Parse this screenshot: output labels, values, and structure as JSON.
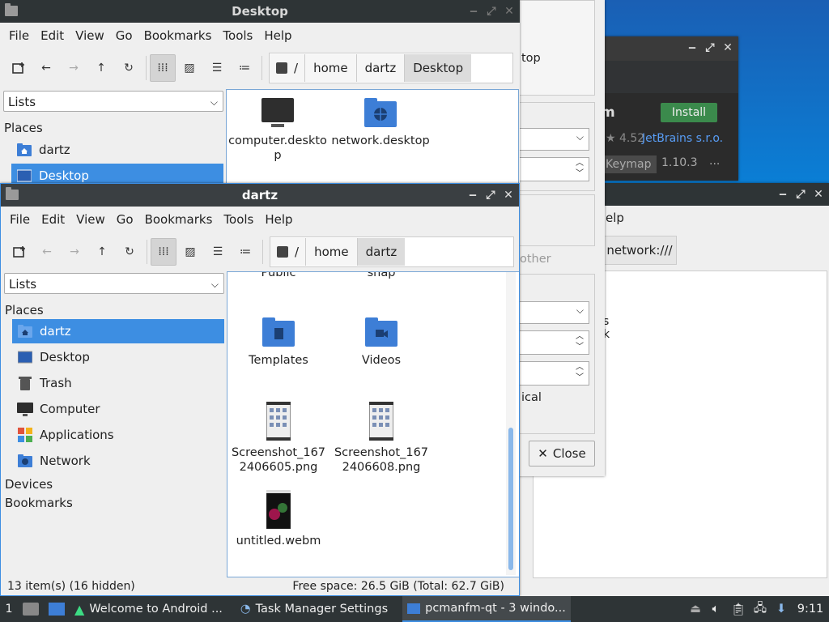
{
  "menu": [
    "File",
    "Edit",
    "View",
    "Go",
    "Bookmarks",
    "Tools",
    "Help"
  ],
  "crumbs": {
    "root": "/",
    "home": "home",
    "user": "dartz",
    "desktop": "Desktop"
  },
  "win_desktop": {
    "title": "Desktop",
    "combo": "Lists",
    "places_heading": "Places",
    "places": [
      {
        "label": "dartz"
      },
      {
        "label": "Desktop"
      }
    ],
    "files": [
      {
        "name": "computer.desktop",
        "icon": "monitor-icon"
      },
      {
        "name": "network.desktop",
        "icon": "network-folder-icon"
      }
    ]
  },
  "win_dartz": {
    "title": "dartz",
    "combo": "Lists",
    "places_heading": "Places",
    "places": [
      {
        "label": "dartz",
        "icon": "home-folder-icon"
      },
      {
        "label": "Desktop",
        "icon": "desktop-icon"
      },
      {
        "label": "Trash",
        "icon": "trash-icon"
      },
      {
        "label": "Computer",
        "icon": "computer-icon"
      },
      {
        "label": "Applications",
        "icon": "applications-icon"
      },
      {
        "label": "Network",
        "icon": "network-icon"
      }
    ],
    "devices_heading": "Devices",
    "bookmarks_heading": "Bookmarks",
    "files_partial": [
      "Public",
      "snap"
    ],
    "files": [
      {
        "name": "Templates",
        "icon": "templates-folder-icon"
      },
      {
        "name": "Videos",
        "icon": "videos-folder-icon"
      },
      {
        "name": "Screenshot_1672406605.png",
        "l1": "Screenshot_167",
        "l2": "2406605.png",
        "icon": "image-thumbnail"
      },
      {
        "name": "Screenshot_1672406608.png",
        "l1": "Screenshot_167",
        "l2": "2406608.png",
        "icon": "image-thumbnail"
      },
      {
        "name": "untitled.webm",
        "icon": "video-thumbnail"
      }
    ],
    "status_left": "13 item(s) (16 hidden)",
    "status_right": "Free space: 26.5 GiB (Total: 62.7 GiB)"
  },
  "dialog_back": {
    "frag_top": "top",
    "frag_other": "other",
    "frag_ical": "ical",
    "close_label": "Close"
  },
  "plugin_window": {
    "frag_m": "m",
    "install_label": "Install",
    "rating": "4.52",
    "vendor": "JetBrains s.r.o.",
    "tag": "Keymap",
    "version": "1.10.3",
    "more": "..."
  },
  "fm_back": {
    "menu_help": "elp",
    "path": "network:///",
    "frag_s": "s",
    "frag_k": "k"
  },
  "taskbar": {
    "workspace": "1",
    "tasks": [
      {
        "label": "Welcome to Android ...",
        "icon": "android-icon"
      },
      {
        "label": "Task Manager Settings",
        "icon": "task-manager-icon"
      },
      {
        "label": "pcmanfm-qt - 3 windo...",
        "icon": "folder-icon"
      }
    ],
    "clock": "9:11"
  }
}
